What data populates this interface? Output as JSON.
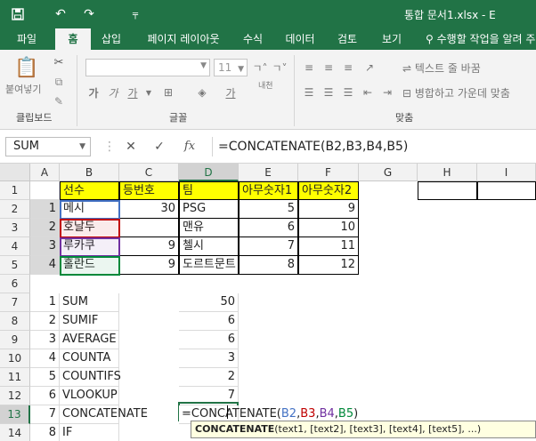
{
  "window": {
    "title": "통합 문서1.xlsx - E"
  },
  "quick_access": {
    "save_icon": "save-icon",
    "undo_icon": "undo-icon",
    "redo_icon": "redo-icon",
    "customize_icon": "customize-icon"
  },
  "ribbon_tabs": [
    {
      "label": "파일"
    },
    {
      "label": "홈"
    },
    {
      "label": "삽입"
    },
    {
      "label": "페이지 레이아웃"
    },
    {
      "label": "수식"
    },
    {
      "label": "데이터"
    },
    {
      "label": "검토"
    },
    {
      "label": "보기"
    }
  ],
  "tell_me": {
    "label": "수행할 작업을 알려 주"
  },
  "ribbon": {
    "clipboard": {
      "paste_label": "붙여넣기",
      "group_label": "클립보드"
    },
    "font": {
      "font_name": "",
      "font_size": "11",
      "bold": "가",
      "italic": "가",
      "underline": "가",
      "phonetic": "내천",
      "group_label": "글꼴"
    },
    "alignment": {
      "wrap_text": "텍스트 줄 바꿈",
      "merge_center": "병합하고 가운데 맞춤",
      "group_label": "맞춤"
    }
  },
  "formula_bar": {
    "name_box": "SUM",
    "cancel": "✕",
    "enter": "✓",
    "fx": "fx",
    "formula": "=CONCATENATE(B2,B3,B4,B5)"
  },
  "columns": [
    "A",
    "B",
    "C",
    "D",
    "E",
    "F",
    "G",
    "H",
    "I"
  ],
  "rows": [
    "1",
    "2",
    "3",
    "4",
    "5",
    "6",
    "7",
    "8",
    "9",
    "10",
    "11",
    "12",
    "13",
    "14"
  ],
  "sheet": {
    "r1": {
      "b": "선수",
      "c": "등번호",
      "d": "팀",
      "e": "아무숫자1",
      "f": "아무숫자2"
    },
    "r2": {
      "a": "1",
      "b": "메시",
      "c": "30",
      "d": "PSG",
      "e": "5",
      "f": "9"
    },
    "r3": {
      "a": "2",
      "b": "호날두",
      "c": "",
      "d": "맨유",
      "e": "6",
      "f": "10"
    },
    "r4": {
      "a": "3",
      "b": "루카쿠",
      "c": "9",
      "d": "첼시",
      "e": "7",
      "f": "11"
    },
    "r5": {
      "a": "4",
      "b": "홀란드",
      "c": "9",
      "d": "도르트문트",
      "e": "8",
      "f": "12"
    },
    "r7": {
      "a": "1",
      "b": "SUM",
      "d": "50"
    },
    "r8": {
      "a": "2",
      "b": "SUMIF",
      "d": "6"
    },
    "r9": {
      "a": "3",
      "b": "AVERAGE",
      "d": "6"
    },
    "r10": {
      "a": "4",
      "b": "COUNTA",
      "d": "3"
    },
    "r11": {
      "a": "5",
      "b": "COUNTIFS",
      "d": "2"
    },
    "r12": {
      "a": "6",
      "b": "VLOOKUP",
      "d": "7"
    },
    "r13": {
      "a": "7",
      "b": "CONCATENATE"
    },
    "r14": {
      "a": "8",
      "b": "IF"
    }
  },
  "edit_formula": {
    "prefix": "=CONCATENATE(",
    "b2": "B2",
    "c1": ",",
    "b3": "B3",
    "c2": ",",
    "b4": "B4",
    "c3": ",",
    "b5": "B5",
    "suffix": ")"
  },
  "tooltip": {
    "func": "CONCATENATE",
    "args": "(text1, [text2], [text3], [text4], [text5], ...)"
  },
  "colors": {
    "excel_green": "#217346",
    "header_yellow": "#ffff00",
    "ref_b2": "#4472c4",
    "ref_b3": "#c00000",
    "ref_b4": "#7030a0",
    "ref_b5": "#00883a"
  }
}
